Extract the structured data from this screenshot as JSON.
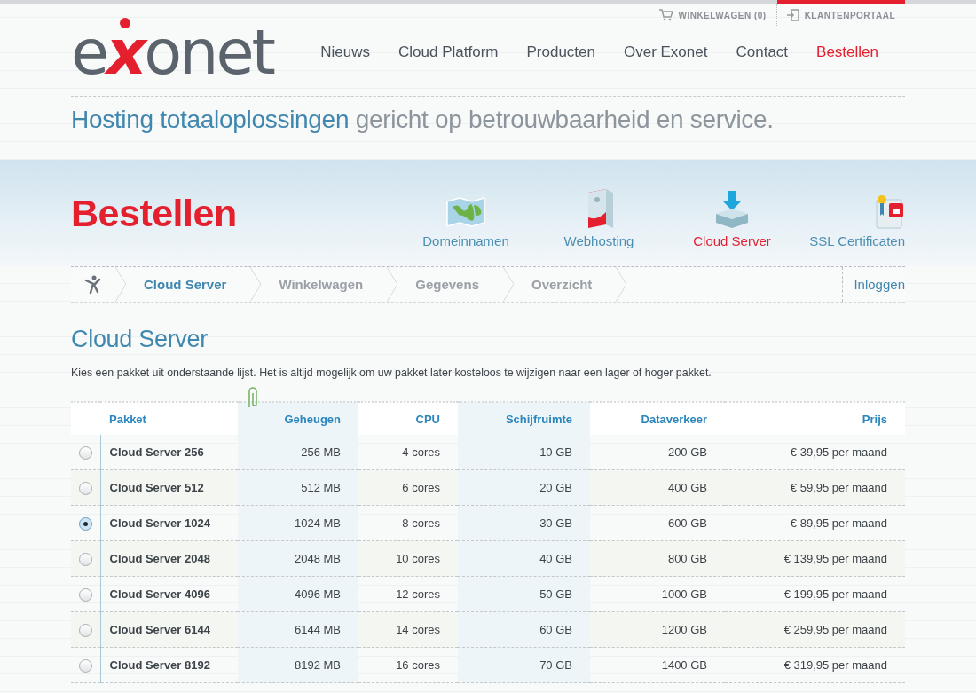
{
  "top_links": [
    {
      "kind": "cart",
      "label": "WINKELWAGEN (0)",
      "selected": false
    },
    {
      "kind": "portal",
      "label": "KLANTENPORTAAL",
      "selected": true
    }
  ],
  "logo": [
    {
      "text": "e",
      "accent": false
    },
    {
      "text": "x",
      "accent": true
    },
    {
      "text": "onet",
      "accent": false
    }
  ],
  "nav": [
    {
      "label": "Nieuws",
      "selected": false
    },
    {
      "label": "Cloud Platform",
      "selected": false
    },
    {
      "label": "Producten",
      "selected": false
    },
    {
      "label": "Over Exonet",
      "selected": false
    },
    {
      "label": "Contact",
      "selected": false
    },
    {
      "label": "Bestellen",
      "selected": true
    }
  ],
  "tagline": {
    "highlight": "Hosting totaaloplossingen",
    "rest": "gericht op betrouwbaarheid en service."
  },
  "banner": {
    "title": "Bestellen",
    "categories": [
      {
        "kind": "map",
        "label": "Domeinnamen",
        "selected": false
      },
      {
        "kind": "box",
        "label": "Webhosting",
        "selected": false
      },
      {
        "kind": "server",
        "label": "Cloud Server",
        "selected": true
      },
      {
        "kind": "certificate",
        "label": "SSL Certificaten",
        "selected": false
      }
    ]
  },
  "steps": [
    {
      "label": "Cloud Server",
      "selected": true
    },
    {
      "label": "Winkelwagen",
      "selected": false
    },
    {
      "label": "Gegevens",
      "selected": false
    },
    {
      "label": "Overzicht",
      "selected": false
    }
  ],
  "login": "Inloggen",
  "heading": "Cloud Server",
  "intro": "Kies een pakket uit onderstaande lijst. Het is altijd mogelijk om uw pakket later kosteloos te wijzigen naar een lager of hoger pakket.",
  "table": {
    "columns": [
      "Pakket",
      "Geheugen",
      "CPU",
      "Schijfruimte",
      "Dataverkeer",
      "Prijs"
    ],
    "rows": [
      {
        "selected": false,
        "cells": [
          "Cloud Server 256",
          "256 MB",
          "4 cores",
          "10 GB",
          "200 GB",
          "€ 39,95 per maand"
        ]
      },
      {
        "selected": false,
        "cells": [
          "Cloud Server 512",
          "512 MB",
          "6 cores",
          "20 GB",
          "400 GB",
          "€ 59,95 per maand"
        ]
      },
      {
        "selected": true,
        "cells": [
          "Cloud Server 1024",
          "1024 MB",
          "8 cores",
          "30 GB",
          "600 GB",
          "€ 89,95 per maand"
        ]
      },
      {
        "selected": false,
        "cells": [
          "Cloud Server 2048",
          "2048 MB",
          "10 cores",
          "40 GB",
          "800 GB",
          "€ 139,95 per maand"
        ]
      },
      {
        "selected": false,
        "cells": [
          "Cloud Server 4096",
          "4096 MB",
          "12 cores",
          "50 GB",
          "1000 GB",
          "€ 199,95 per maand"
        ]
      },
      {
        "selected": false,
        "cells": [
          "Cloud Server 6144",
          "6144 MB",
          "14 cores",
          "60 GB",
          "1200 GB",
          "€ 259,95 per maand"
        ]
      },
      {
        "selected": false,
        "cells": [
          "Cloud Server 8192",
          "8192 MB",
          "16 cores",
          "70 GB",
          "1400 GB",
          "€ 319,95 per maand"
        ]
      }
    ]
  }
}
